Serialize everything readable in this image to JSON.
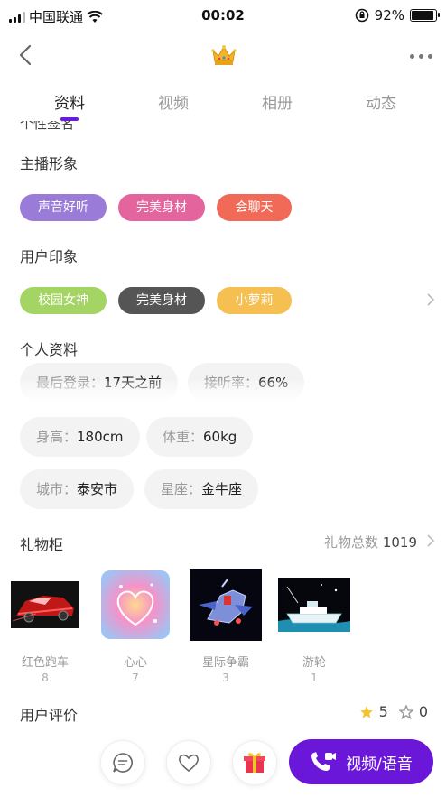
{
  "status_bar": {
    "carrier": "中国联通",
    "time": "00:02",
    "battery": "92%",
    "battery_level": 0.92
  },
  "nav": {
    "back_icon": "chevron-left-icon",
    "center_icon": "crown-icon",
    "more_icon": "more-dots-icon"
  },
  "tabs": [
    {
      "label": "资料",
      "active": true
    },
    {
      "label": "视频",
      "active": false
    },
    {
      "label": "相册",
      "active": false
    },
    {
      "label": "动态",
      "active": false
    }
  ],
  "clipped_heading": "个性签名",
  "host_image": {
    "title": "主播形象",
    "tags": [
      {
        "label": "声音好听",
        "color": "#9a7cd8"
      },
      {
        "label": "完美身材",
        "color": "#e4649d"
      },
      {
        "label": "会聊天",
        "color": "#f06a57"
      }
    ]
  },
  "user_impression": {
    "title": "用户印象",
    "tags": [
      {
        "label": "校园女神",
        "color": "#a4d463"
      },
      {
        "label": "完美身材",
        "color": "#555555"
      },
      {
        "label": "小萝莉",
        "color": "#f6bf52"
      }
    ]
  },
  "profile": {
    "title": "个人资料",
    "items": [
      {
        "key": "最后登录：",
        "value": "17天之前"
      },
      {
        "key": "接听率：",
        "value": "66%"
      },
      {
        "key": "身高：",
        "value": "180cm"
      },
      {
        "key": "体重：",
        "value": "60kg"
      },
      {
        "key": "城市：",
        "value": "泰安市"
      },
      {
        "key": "星座：",
        "value": "金牛座"
      }
    ]
  },
  "gifts": {
    "title": "礼物柜",
    "total_label": "礼物总数",
    "total": "1019",
    "items": [
      {
        "name": "红色跑车",
        "count": "8"
      },
      {
        "name": "心心",
        "count": "7"
      },
      {
        "name": "星际争霸",
        "count": "3"
      },
      {
        "name": "游轮",
        "count": "1"
      }
    ]
  },
  "reviews": {
    "title": "用户评价",
    "good": "5",
    "bad": "0"
  },
  "bottom": {
    "chat_icon": "chat-bubble-icon",
    "like_icon": "heart-icon",
    "gift_icon": "gift-box-icon",
    "call_label": "视频/语音",
    "call_icon": "phone-video-icon"
  },
  "colors": {
    "accent": "#6a17d9"
  }
}
